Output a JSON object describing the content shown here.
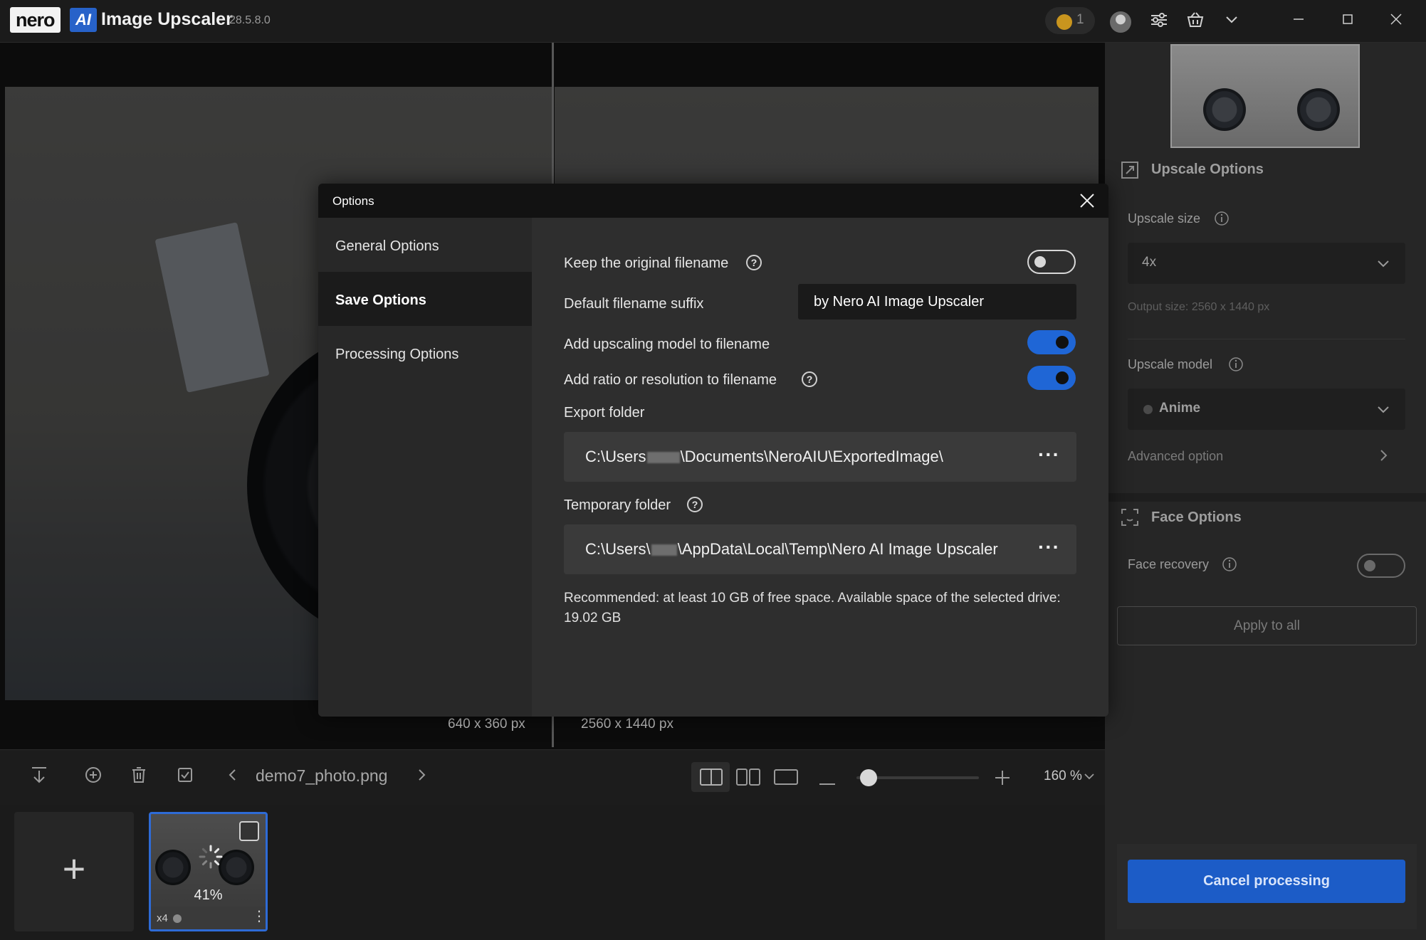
{
  "app": {
    "brand": "nero",
    "ai_badge": "AI",
    "title": "Image Upscaler",
    "version": "28.5.8.0",
    "credits": "1"
  },
  "canvas": {
    "original_size": "640 x 360 px",
    "upscaled_size": "2560 x 1440 px"
  },
  "toolbar": {
    "filename": "demo7_photo.png",
    "zoom": "160 %",
    "zoom_slider_fraction": 0.1
  },
  "filmstrip": {
    "add_label": "+",
    "items": [
      {
        "progress": "41%",
        "scale": "x4"
      }
    ]
  },
  "right_panel": {
    "upscale_title": "Upscale Options",
    "upscale_size_label": "Upscale size",
    "upscale_size_value": "4x",
    "output_size": "Output size: 2560 x 1440 px",
    "upscale_model_label": "Upscale model",
    "upscale_model_value": "Anime",
    "advanced_option": "Advanced option",
    "face_title": "Face Options",
    "face_recovery_label": "Face recovery",
    "apply_all": "Apply to all",
    "cancel": "Cancel processing"
  },
  "modal": {
    "title": "Options",
    "nav": [
      {
        "label": "General Options"
      },
      {
        "label": "Save Options"
      },
      {
        "label": "Processing Options"
      }
    ],
    "keep_filename_label": "Keep the original filename",
    "suffix_label": "Default filename suffix",
    "suffix_value": "by Nero AI Image Upscaler",
    "add_model_label": "Add upscaling model to filename",
    "add_ratio_label": "Add ratio or resolution to filename",
    "export_folder_label": "Export folder",
    "export_path_pre": "C:\\Users",
    "export_path_post": "\\Documents\\NeroAIU\\ExportedImage\\",
    "temp_folder_label": "Temporary folder",
    "temp_path_pre": "C:\\Users\\",
    "temp_path_post": "\\AppData\\Local\\Temp\\Nero AI Image Upscaler",
    "recommendation": "Recommended: at least 10 GB of free space. Available space of the selected drive: 19.02 GB"
  }
}
